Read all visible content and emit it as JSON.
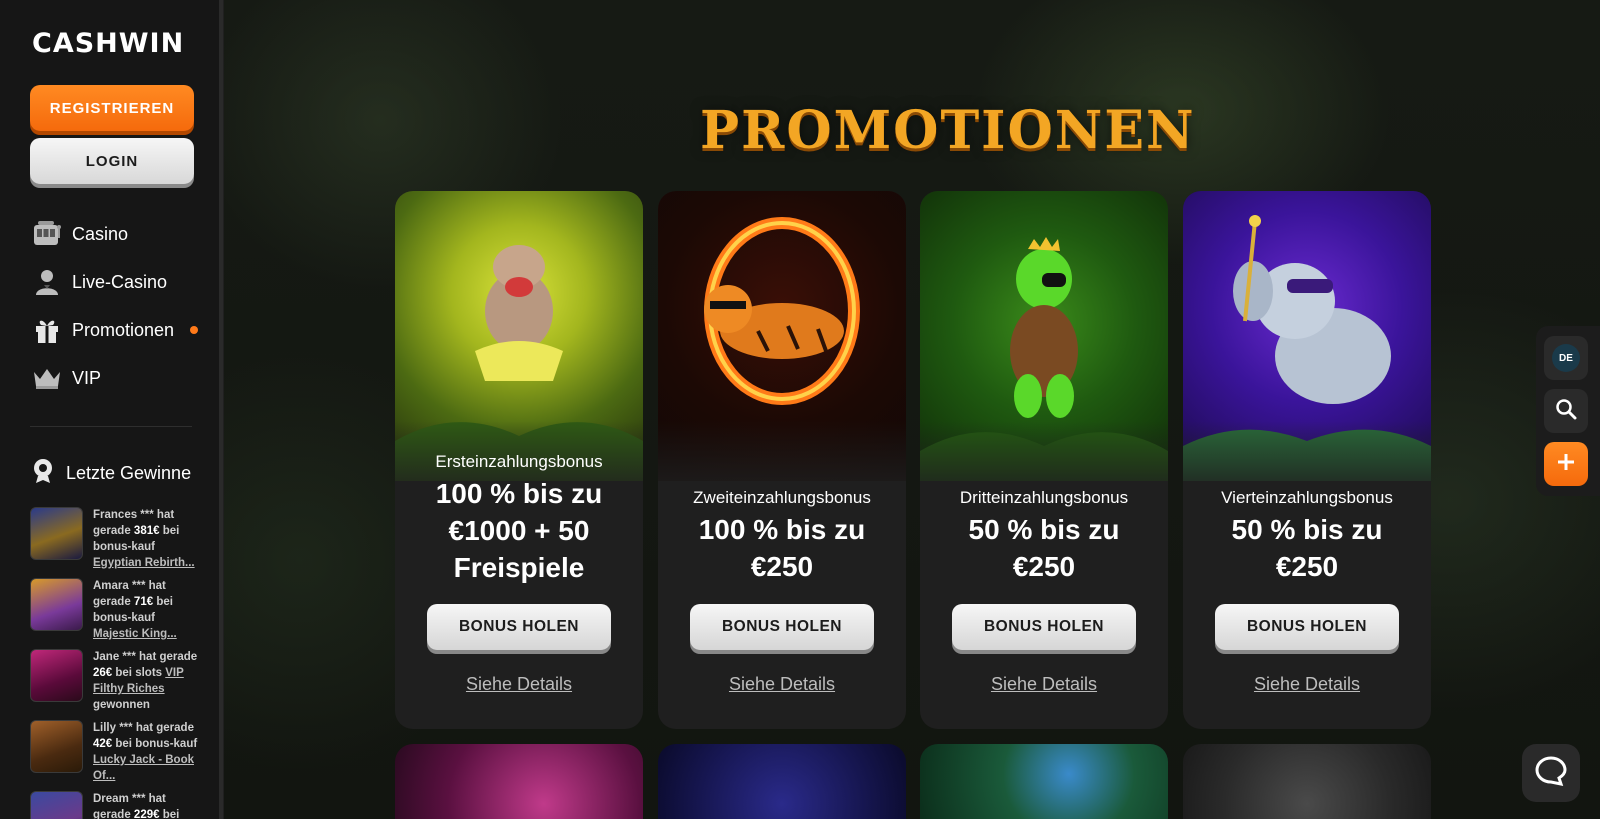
{
  "brand": {
    "logo": "CASHWIN"
  },
  "auth": {
    "register_label": "REGISTRIEREN",
    "login_label": "LOGIN"
  },
  "nav": [
    {
      "label": "Casino",
      "icon": "slot-machine-icon"
    },
    {
      "label": "Live-Casino",
      "icon": "dealer-icon"
    },
    {
      "label": "Promotionen",
      "icon": "gift-icon",
      "badge": true
    },
    {
      "label": "VIP",
      "icon": "crown-icon"
    }
  ],
  "winners": {
    "title": "Letzte Gewinne",
    "items": [
      {
        "name": "Frances *** hat gerade",
        "amount": "381€",
        "mid": "bei bonus-kauf",
        "game": "Egyptian Rebirth..."
      },
      {
        "name": "Amara *** hat gerade",
        "amount": "71€",
        "mid": "bei bonus-kauf",
        "game": "Majestic King..."
      },
      {
        "name": "Jane *** hat gerade",
        "amount": "26€",
        "mid": "bei slots",
        "game": "VIP Filthy Riches",
        "suffix": "gewonnen"
      },
      {
        "name": "Lilly *** hat gerade",
        "amount": "42€",
        "mid": "bei bonus-kauf",
        "game": "Lucky Jack - Book Of..."
      },
      {
        "name": "Dream *** hat gerade",
        "amount": "229€",
        "mid": "bei",
        "game": ""
      }
    ]
  },
  "page": {
    "title": "PROMOTIONEN"
  },
  "promotions": [
    {
      "subtitle": "Ersteinzahlungsbonus",
      "headline": "100 % bis zu €1000 + 50 Freispiele",
      "button": "BONUS HOLEN",
      "details": "Siehe Details"
    },
    {
      "subtitle": "Zweiteinzahlungsbonus",
      "headline": "100 % bis zu €250",
      "button": "BONUS HOLEN",
      "details": "Siehe Details"
    },
    {
      "subtitle": "Dritteinzahlungsbonus",
      "headline": "50 % bis zu €250",
      "button": "BONUS HOLEN",
      "details": "Siehe Details"
    },
    {
      "subtitle": "Vierteinzahlungsbonus",
      "headline": "50 % bis zu €250",
      "button": "BONUS HOLEN",
      "details": "Siehe Details"
    }
  ],
  "toolbar": {
    "language": "DE"
  },
  "colors": {
    "accent": "#f56a0c",
    "title_gold": "#f3a624",
    "card_bg": "#1f1f1f"
  }
}
